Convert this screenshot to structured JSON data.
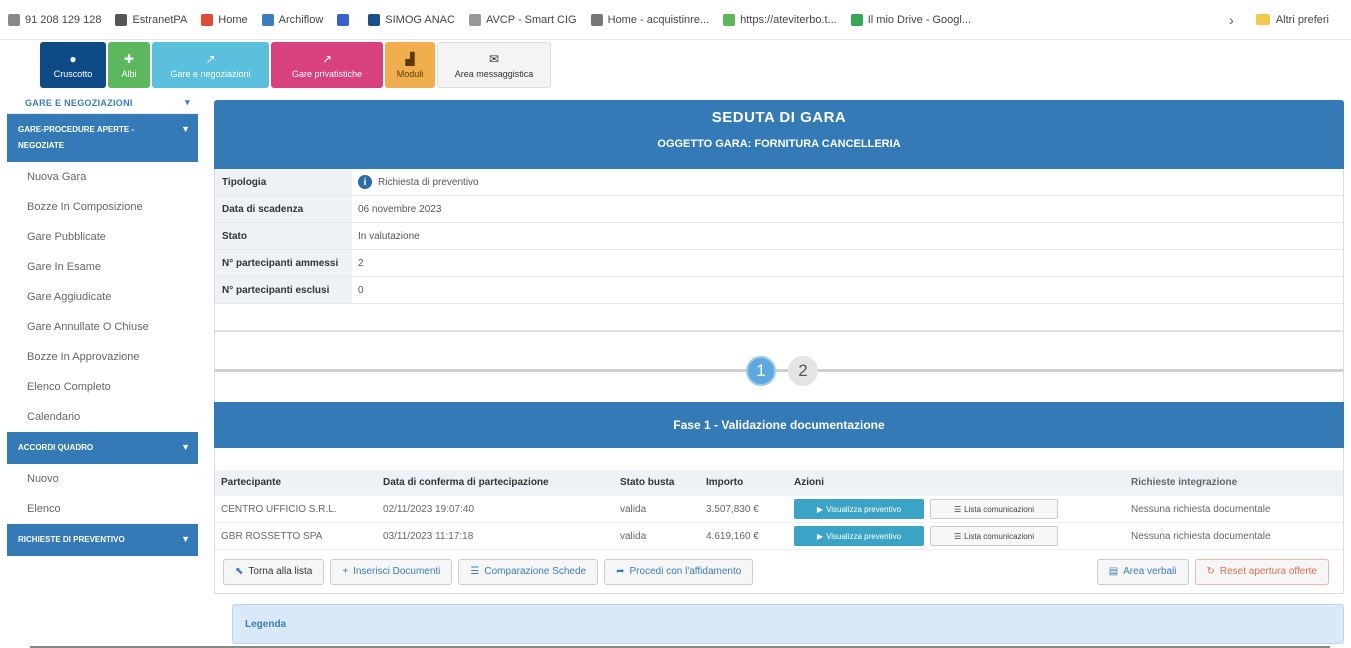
{
  "bookmarks": [
    {
      "label": "91 208 129 128",
      "color": "#888888",
      "icon": "page-icon"
    },
    {
      "label": "EstranetPA",
      "color": "#555555",
      "icon": "grid-icon"
    },
    {
      "label": "Home",
      "color": "#e24a33",
      "icon": "flower-icon"
    },
    {
      "label": "Archiflow",
      "color": "#3a7dbf",
      "icon": "doc-icon"
    },
    {
      "label": "",
      "color": "#3a5fcf",
      "icon": "u-icon"
    },
    {
      "label": "SIMOG ANAC",
      "color": "#1b4f8a",
      "icon": "a-icon"
    },
    {
      "label": "AVCP - Smart CIG",
      "color": "#999999",
      "icon": "a-small-icon"
    },
    {
      "label": "Home - acquistinre...",
      "color": "#777777",
      "icon": "page-icon"
    },
    {
      "label": "https://ateviterbo.t...",
      "color": "#5cb85c",
      "icon": "link-icon"
    },
    {
      "label": "Il mio Drive - Googl...",
      "color": "#34a853",
      "icon": "drive-icon"
    }
  ],
  "bookmarks_more": "Altri preferi",
  "toolbar": [
    {
      "label": "Cruscotto",
      "glyph": "●",
      "style": "tb-dark",
      "icon": "dashboard-icon"
    },
    {
      "label": "Albi",
      "glyph": "✚",
      "style": "tb-green",
      "icon": "albi-icon"
    },
    {
      "label": "Gare e negoziazioni",
      "glyph": "↗",
      "style": "tb-cyan",
      "icon": "hammer-icon"
    },
    {
      "label": "Gare privatistiche",
      "glyph": "↗",
      "style": "tb-pink",
      "icon": "hammer-icon"
    },
    {
      "label": "Moduli",
      "glyph": "▟",
      "style": "tb-orange",
      "icon": "modules-icon"
    },
    {
      "label": "Area messaggistica",
      "glyph": "✉",
      "style": "tb-grey",
      "icon": "envelope-icon"
    }
  ],
  "sidebar": {
    "header": "GARE E NEGOZIAZIONI",
    "section1": "GARE-PROCEDURE APERTE - NEGOZIATE",
    "items1": [
      "Nuova Gara",
      "Bozze In Composizione",
      "Gare Pubblicate",
      "Gare In Esame",
      "Gare Aggiudicate",
      "Gare Annullate O Chiuse",
      "Bozze In Approvazione",
      "Elenco Completo",
      "Calendario"
    ],
    "section2": "ACCORDI QUADRO",
    "items2": [
      "Nuovo",
      "Elenco"
    ],
    "section3": "RICHIESTE DI PREVENTIVO"
  },
  "header": {
    "title": "SEDUTA DI GARA",
    "subtitle": "OGGETTO GARA: FORNITURA CANCELLERIA"
  },
  "info": [
    {
      "key": "Tipologia",
      "value": "Richiesta di preventivo",
      "has_icon": true
    },
    {
      "key": "Data di scadenza",
      "value": "06 novembre 2023"
    },
    {
      "key": "Stato",
      "value": "In valutazione"
    },
    {
      "key": "N° partecipanti ammessi",
      "value": "2"
    },
    {
      "key": "N° partecipanti esclusi",
      "value": "0"
    }
  ],
  "steps": [
    "1",
    "2"
  ],
  "phase_title": "Fase 1 - Validazione documentazione",
  "table": {
    "columns": [
      "Partecipante",
      "Data di conferma di partecipazione",
      "Stato busta",
      "Importo",
      "Azioni",
      "Richieste integrazione"
    ],
    "rows": [
      {
        "participant": "CENTRO UFFICIO S.R.L.",
        "date": "02/11/2023 19:07:40",
        "status": "valida",
        "amount": "3.507,830 €",
        "btn_view": "Visualizza preventivo",
        "btn_list": "Lista comunicazioni",
        "request": "Nessuna richiesta documentale"
      },
      {
        "participant": "GBR ROSSETTO SPA",
        "date": "03/11/2023 11:17:18",
        "status": "valida",
        "amount": "4.619,160 €",
        "btn_view": "Visualizza preventivo",
        "btn_list": "Lista comunicazioni",
        "request": "Nessuna richiesta documentale"
      }
    ]
  },
  "actions": {
    "back": "Torna alla lista",
    "insert": "Inserisci Documenti",
    "compare": "Comparazione Schede",
    "proceed": "Procedi con l'affidamento",
    "verbali": "Area verbali",
    "reset": "Reset apertura offerte"
  },
  "legend": "Legenda"
}
